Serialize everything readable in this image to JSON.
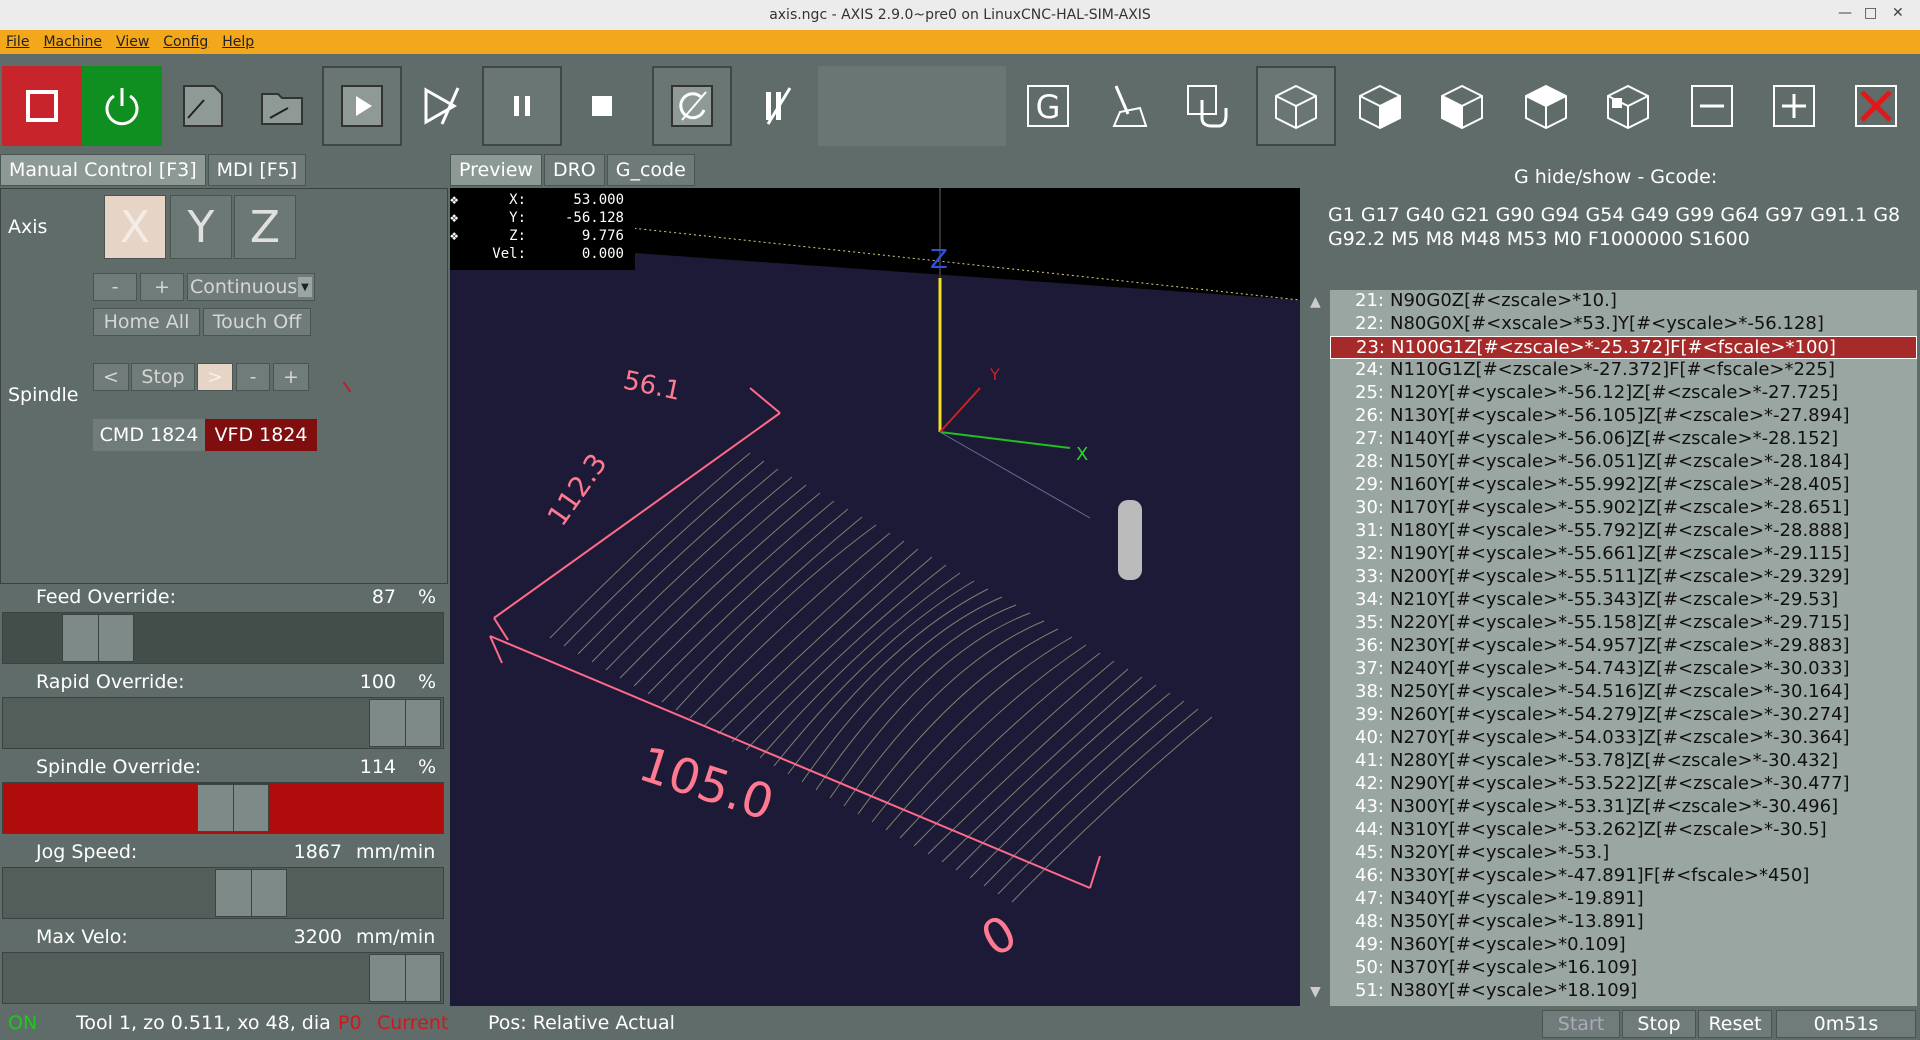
{
  "window": {
    "title": "axis.ngc - AXIS 2.9.0~pre0 on LinuxCNC-HAL-SIM-AXIS"
  },
  "menu": [
    "File",
    "Machine",
    "View",
    "Config",
    "Help"
  ],
  "left_tabs": [
    "Manual Control [F3]",
    "MDI [F5]"
  ],
  "manual": {
    "axis_label": "Axis",
    "axes": [
      "X",
      "Y",
      "Z"
    ],
    "jog_minus": "-",
    "jog_plus": "+",
    "jog_mode": "Continuous",
    "home_all": "Home All",
    "touch_off": "Touch Off",
    "spindle_label": "Spindle",
    "spindle_ccw": "<",
    "spindle_stop": "Stop",
    "spindle_cw": ">",
    "spindle_minus": "-",
    "spindle_plus": "+",
    "cmd_speed": "CMD 1824",
    "vfd_speed": "VFD 1824"
  },
  "overrides": {
    "feed": {
      "label": "Feed Override:",
      "value": "87",
      "unit": "%",
      "fraction": 0.16
    },
    "rapid": {
      "label": "Rapid Override:",
      "value": "100",
      "unit": "%",
      "fraction": 1.0
    },
    "spindle": {
      "label": "Spindle Override:",
      "value": "114",
      "unit": "%",
      "fraction": 0.53
    },
    "jog": {
      "label": "Jog Speed:",
      "value": "1867",
      "unit": "mm/min",
      "fraction": 0.58
    },
    "maxvel": {
      "label": "Max Velo:",
      "value": "3200",
      "unit": "mm/min",
      "fraction": 1.0
    }
  },
  "preview_tabs": [
    "Preview",
    "DRO",
    "G_code"
  ],
  "dro": {
    "x_label": "X:",
    "x": "53.000",
    "y_label": "Y:",
    "y": "-56.128",
    "z_label": "Z:",
    "z": "9.776",
    "vel_label": "Vel:",
    "vel": "0.000"
  },
  "dimensions": {
    "y_extent": "112.3",
    "x_extent": "105.0",
    "top": "56.1",
    "bottom": "0"
  },
  "gcode_header": {
    "title": "G hide/show - Gcode:",
    "modal_line1": "G1 G17 G40 G21 G90 G94 G54 G49 G99 G64 G97 G91.1 G8",
    "modal_line2": "G92.2 M5 M8 M48 M53 M0 F1000000 S1600"
  },
  "gcode_lines": [
    {
      "n": "21:",
      "code": "N90G0Z[#<zscale>*10.]"
    },
    {
      "n": "22:",
      "code": "N80G0X[#<xscale>*53.]Y[#<yscale>*-56.128]"
    },
    {
      "n": "23:",
      "code": "N100G1Z[#<zscale>*-25.372]F[#<fscale>*100]",
      "current": true
    },
    {
      "n": "24:",
      "code": "N110G1Z[#<zscale>*-27.372]F[#<fscale>*225]"
    },
    {
      "n": "25:",
      "code": "N120Y[#<yscale>*-56.12]Z[#<zscale>*-27.725]"
    },
    {
      "n": "26:",
      "code": "N130Y[#<yscale>*-56.105]Z[#<zscale>*-27.894]"
    },
    {
      "n": "27:",
      "code": "N140Y[#<yscale>*-56.06]Z[#<zscale>*-28.152]"
    },
    {
      "n": "28:",
      "code": "N150Y[#<yscale>*-56.051]Z[#<zscale>*-28.184]"
    },
    {
      "n": "29:",
      "code": "N160Y[#<yscale>*-55.992]Z[#<zscale>*-28.405]"
    },
    {
      "n": "30:",
      "code": "N170Y[#<yscale>*-55.902]Z[#<zscale>*-28.651]"
    },
    {
      "n": "31:",
      "code": "N180Y[#<yscale>*-55.792]Z[#<zscale>*-28.888]"
    },
    {
      "n": "32:",
      "code": "N190Y[#<yscale>*-55.661]Z[#<zscale>*-29.115]"
    },
    {
      "n": "33:",
      "code": "N200Y[#<yscale>*-55.511]Z[#<zscale>*-29.329]"
    },
    {
      "n": "34:",
      "code": "N210Y[#<yscale>*-55.343]Z[#<zscale>*-29.53]"
    },
    {
      "n": "35:",
      "code": "N220Y[#<yscale>*-55.158]Z[#<zscale>*-29.715]"
    },
    {
      "n": "36:",
      "code": "N230Y[#<yscale>*-54.957]Z[#<zscale>*-29.883]"
    },
    {
      "n": "37:",
      "code": "N240Y[#<yscale>*-54.743]Z[#<zscale>*-30.033]"
    },
    {
      "n": "38:",
      "code": "N250Y[#<yscale>*-54.516]Z[#<zscale>*-30.164]"
    },
    {
      "n": "39:",
      "code": "N260Y[#<yscale>*-54.279]Z[#<zscale>*-30.274]"
    },
    {
      "n": "40:",
      "code": "N270Y[#<yscale>*-54.033]Z[#<zscale>*-30.364]"
    },
    {
      "n": "41:",
      "code": "N280Y[#<yscale>*-53.78]Z[#<zscale>*-30.432]"
    },
    {
      "n": "42:",
      "code": "N290Y[#<yscale>*-53.522]Z[#<zscale>*-30.477]"
    },
    {
      "n": "43:",
      "code": "N300Y[#<yscale>*-53.31]Z[#<zscale>*-30.496]"
    },
    {
      "n": "44:",
      "code": "N310Y[#<yscale>*-53.262]Z[#<zscale>*-30.5]"
    },
    {
      "n": "45:",
      "code": "N320Y[#<yscale>*-53.]"
    },
    {
      "n": "46:",
      "code": "N330Y[#<yscale>*-47.891]F[#<fscale>*450]"
    },
    {
      "n": "47:",
      "code": "N340Y[#<yscale>*-19.891]"
    },
    {
      "n": "48:",
      "code": "N350Y[#<yscale>*-13.891]"
    },
    {
      "n": "49:",
      "code": "N360Y[#<yscale>*0.109]"
    },
    {
      "n": "50:",
      "code": "N370Y[#<yscale>*16.109]"
    },
    {
      "n": "51:",
      "code": "N380Y[#<yscale>*18.109]"
    }
  ],
  "status": {
    "machine": "ON",
    "tool": "Tool 1, zo 0.511, xo 48, dia 3",
    "p0": "P0",
    "current": "Current",
    "pos": "Pos: Relative Actual",
    "start": "Start",
    "stop": "Stop",
    "reset": "Reset",
    "time": "0m51s"
  },
  "colors": {
    "menu": "#f3a81c",
    "estop": "#c8242b",
    "power": "#0f8f1f",
    "highlight": "#a72a2a",
    "on_text": "#1ec81e",
    "current_text": "#d01818"
  },
  "icons": [
    "estop-icon",
    "power-icon",
    "open-file-icon",
    "reload-file-icon",
    "run-icon",
    "step-icon",
    "pause-icon",
    "stop-icon",
    "restart-icon",
    "optional-stop-icon",
    "g-icon",
    "clear-plot-icon",
    "touch-icon",
    "view-iso-icon",
    "view-top-icon",
    "view-front-icon",
    "view-side-icon",
    "view-p-icon",
    "zoom-out-icon",
    "zoom-in-icon",
    "close-icon"
  ]
}
